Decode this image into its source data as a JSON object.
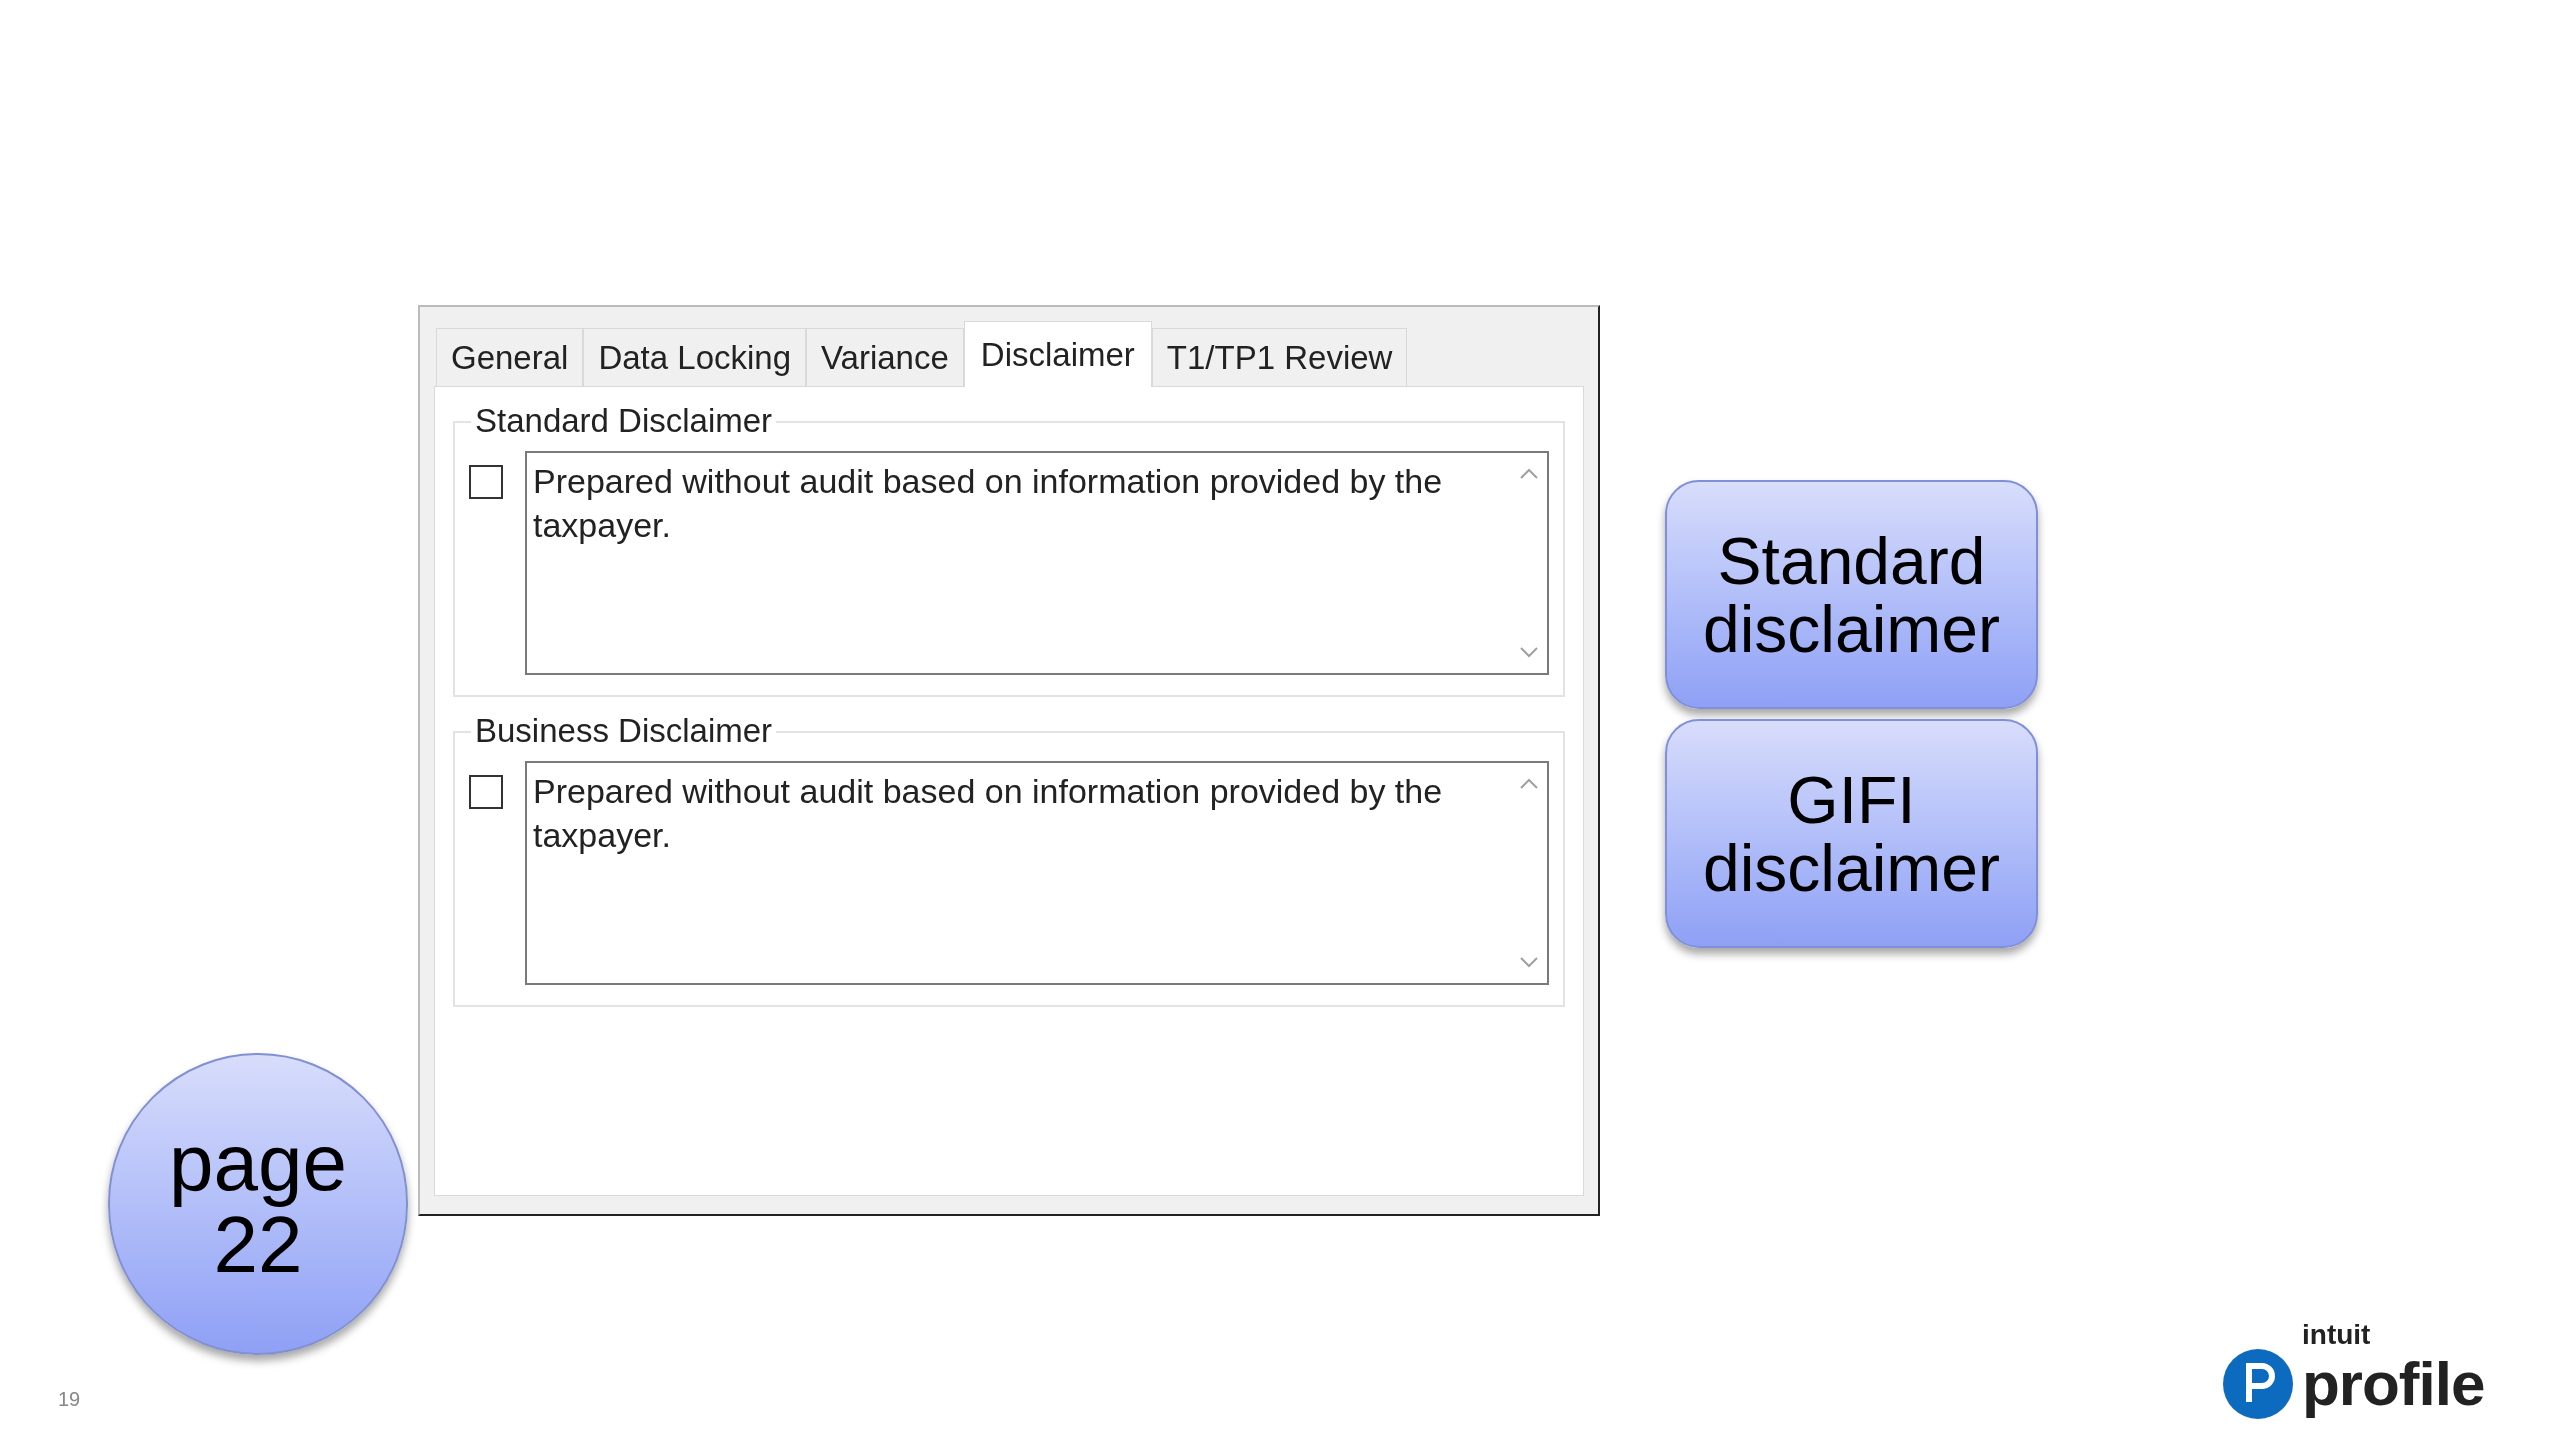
{
  "dialog": {
    "tabs": [
      {
        "label": "General",
        "selected": false
      },
      {
        "label": "Data Locking",
        "selected": false
      },
      {
        "label": "Variance",
        "selected": false
      },
      {
        "label": "Disclaimer",
        "selected": true
      },
      {
        "label": "T1/TP1 Review",
        "selected": false
      }
    ],
    "groups": [
      {
        "title": "Standard Disclaimer",
        "checked": false,
        "text": "Prepared without audit based on information provided by the taxpayer."
      },
      {
        "title": "Business Disclaimer",
        "checked": false,
        "text": "Prepared without audit based on information provided by the taxpayer."
      }
    ]
  },
  "callouts": [
    {
      "label": "Standard disclaimer"
    },
    {
      "label": "GIFI disclaimer"
    }
  ],
  "page_badge": "page 22",
  "slide_number": "19",
  "logo": {
    "brand": "intuit",
    "product": "profile"
  }
}
